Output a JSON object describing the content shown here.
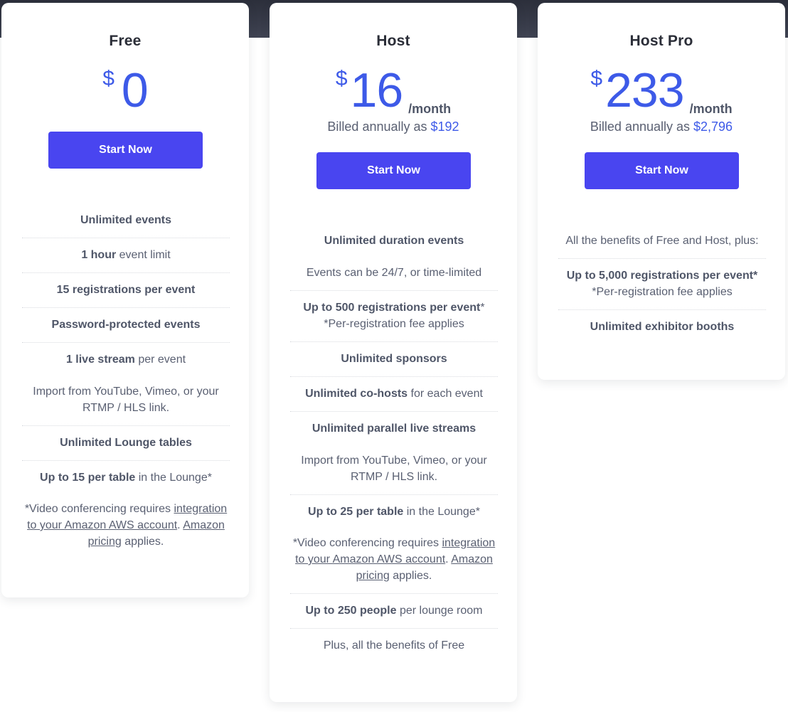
{
  "colors": {
    "accent": "#3d5ae8",
    "button": "#4945f0",
    "text": "#5a6072",
    "heading": "#2b2e38",
    "top_band": "#333745"
  },
  "plans": [
    {
      "name": "Free",
      "currency": "$",
      "amount": "0",
      "period": "",
      "billed_prefix": "",
      "billed_amount": "",
      "cta_label": "Start Now",
      "features": [
        {
          "bold": "Unlimited events",
          "text": ""
        },
        {
          "bold": "1 hour",
          "text": " event limit"
        },
        {
          "bold": "15 registrations per event",
          "text": ""
        },
        {
          "bold": "Password-protected events",
          "text": ""
        },
        {
          "bold": "1 live stream",
          "text": " per event",
          "note": "Import from YouTube, Vimeo, or your RTMP / HLS link."
        },
        {
          "bold": "Unlimited Lounge tables",
          "text": ""
        },
        {
          "bold": "Up to 15 per table",
          "text": " in the Lounge*"
        }
      ],
      "footnote": {
        "prefix": "*Video conferencing requires ",
        "link1": "integration to your Amazon AWS account",
        "middle": ". ",
        "link2": "Amazon pricing",
        "suffix": " applies."
      }
    },
    {
      "name": "Host",
      "currency": "$",
      "amount": "16",
      "period": "/month",
      "billed_prefix": "Billed annually as ",
      "billed_amount": "$192",
      "cta_label": "Start Now",
      "features": [
        {
          "bold": "Unlimited duration events",
          "text": "",
          "note": "Events can be 24/7, or time-limited"
        },
        {
          "bold": "Up to 500 registrations per event",
          "text": "*",
          "note": "*Per-registration fee applies"
        },
        {
          "bold": "Unlimited sponsors",
          "text": ""
        },
        {
          "bold": "Unlimited co-hosts",
          "text": " for each event"
        },
        {
          "bold": "Unlimited parallel live streams",
          "text": "",
          "note": "Import from YouTube, Vimeo, or your RTMP / HLS link."
        },
        {
          "bold": "Up to 25 per table",
          "text": " in the Lounge*"
        },
        {
          "bold": "Up to 250 people",
          "text": " per lounge room"
        },
        {
          "bold": "",
          "text": "Plus, all the benefits of Free"
        }
      ],
      "footnote": {
        "prefix": "*Video conferencing requires ",
        "link1": "integration to your Amazon AWS account",
        "middle": ". ",
        "link2": "Amazon pricing",
        "suffix": " applies."
      }
    },
    {
      "name": "Host Pro",
      "currency": "$",
      "amount": "233",
      "period": "/month",
      "billed_prefix": "Billed annually as ",
      "billed_amount": "$2,796",
      "cta_label": "Start Now",
      "features": [
        {
          "bold": "",
          "text": "All the benefits of Free and Host, plus:"
        },
        {
          "bold": "Up to 5,000 registrations per event*",
          "text": "",
          "note": "*Per-registration fee applies"
        },
        {
          "bold": "Unlimited exhibitor booths",
          "text": ""
        }
      ]
    }
  ]
}
